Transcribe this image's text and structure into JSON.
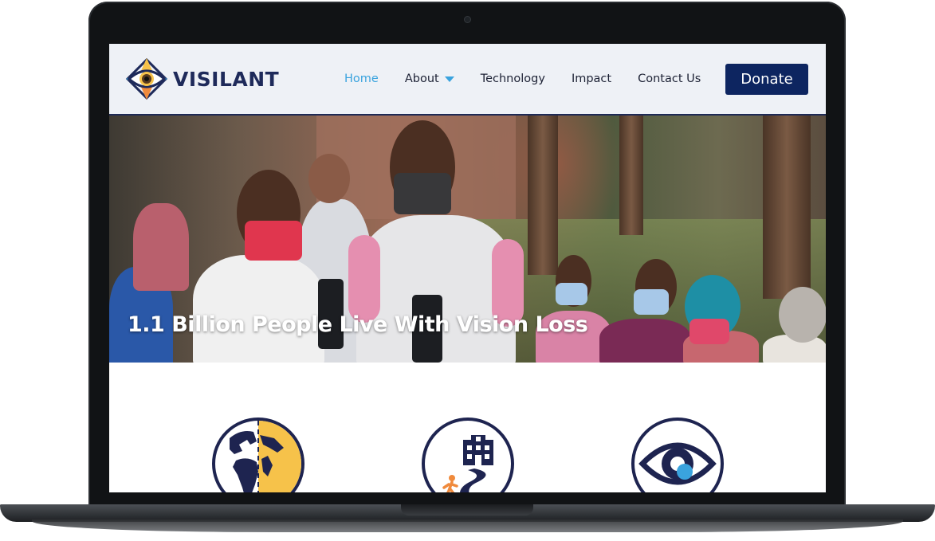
{
  "brand": {
    "name": "VISILANT"
  },
  "nav": {
    "items": [
      {
        "label": "Home",
        "active": true
      },
      {
        "label": "About",
        "has_dropdown": true
      },
      {
        "label": "Technology"
      },
      {
        "label": "Impact"
      },
      {
        "label": "Contact Us"
      }
    ],
    "donate_label": "Donate"
  },
  "hero": {
    "title": "1.1 Billion People Live With Vision Loss",
    "image": "health-workers-with-devices-photo"
  },
  "features": {
    "icons": [
      "globe-icon",
      "hospital-road-icon",
      "eye-icon"
    ]
  },
  "colors": {
    "navy": "#1e2a5a",
    "accent_blue": "#3aa3de",
    "donate_bg": "#0d2560",
    "header_bg": "#eef1f6",
    "yellow": "#f6c24a",
    "orange": "#f08a3c"
  }
}
